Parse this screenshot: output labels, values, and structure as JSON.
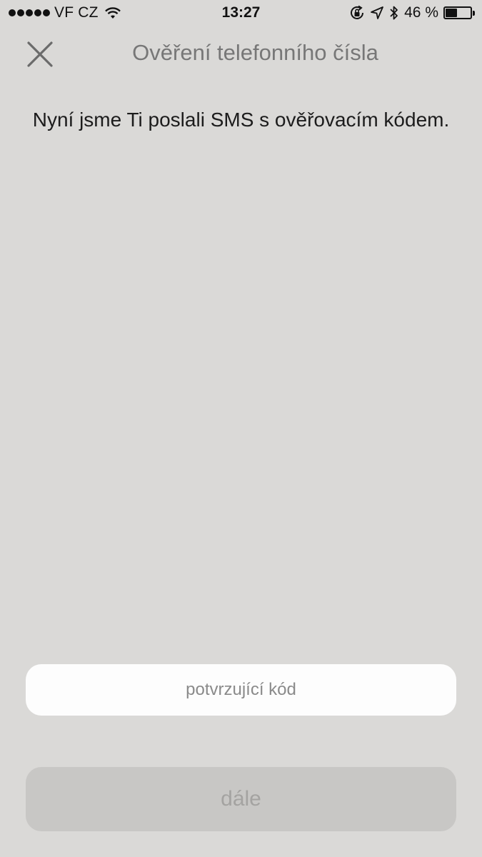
{
  "status_bar": {
    "carrier": "VF CZ",
    "time": "13:27",
    "battery_percent_label": "46 %",
    "battery_level": 0.46,
    "icons": [
      "signal-dots-icon",
      "wifi-icon",
      "orientation-lock-icon",
      "location-arrow-icon",
      "bluetooth-icon",
      "battery-icon"
    ]
  },
  "header": {
    "title": "Ověření telefonního čísla",
    "close_icon": "close-icon"
  },
  "main": {
    "info_text": "Nyní jsme Ti poslali SMS s ověřovacím kódem."
  },
  "form": {
    "code_input": {
      "placeholder": "potvrzující kód",
      "value": ""
    },
    "next_label": "dále"
  },
  "colors": {
    "background": "#dad9d7",
    "title": "#777777",
    "input_bg": "#fdfdfd",
    "button_bg": "#c8c7c5",
    "button_text": "#a4a3a1"
  }
}
